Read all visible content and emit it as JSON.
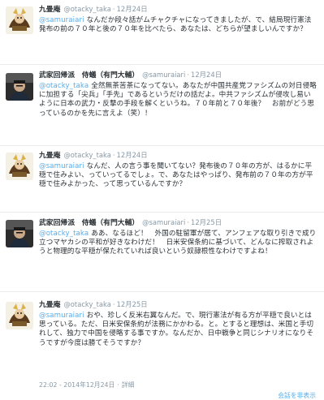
{
  "tweets": [
    {
      "name": "九畳庵",
      "handle": "@otacky_taka",
      "time": "12月24日",
      "mention": "@samuraiari",
      "text": "なんだか段々話がムチャクチャになってきましたが、で、結局現行憲法発布の前の７０年と後の７０年を比べたら、あなたは、どちらが望ましいんですか？"
    },
    {
      "name": "武家回帰派　侍蟻（有門大輔）",
      "handle": "@samuraiari",
      "time": "12月24日",
      "mention": "@otacky_taka",
      "text": "全然無茶苦茶になってない。あなたが中国共産党ファシズムの対日侵略に加担する「尖兵」「手先」であるというだけの話だよ。中共ファシズムが侵攻し易いように日本の武力・反撃の手段を解くというね。７０年前と７０年後？　お前がどう思っているのかを先に言えよ（笑）！"
    },
    {
      "name": "九畳庵",
      "handle": "@otacky_taka",
      "time": "12月24日",
      "mention": "@samuraiari",
      "text": "なんだ、人の言う事を聞いてない？発布後の７０年の方が、はるかに平穏で住みよい、っていってるでしょ。で、あなたはやっぱり、発布前の７０年の方が平穏で住みよかった、って思っているんですか？"
    },
    {
      "name": "武家回帰派　侍蟻（有門大輔）",
      "handle": "@samuraiari",
      "time": "12月25日",
      "mention": "@otacky_taka",
      "text": "ああ、なるほど！　外国の駐留軍が居て、アンフェアな取り引きで成り立つマヤカシの平和が好きなわけだ！　日米安保条約に基づいて、どんなに搾取されようと物理的な平穏が保たれていれば良いという奴隷根性なわけですよね！"
    },
    {
      "name": "九畳庵",
      "handle": "@otacky_taka",
      "time": "12月25日",
      "mention": "@samuraiari",
      "text": "おや、珍しく反米右翼なんだ。で、現行憲法が有る方が平穏で良いとは思っている。ただ、日米安保条約が法務にかかわる。と。とすると理想は、米国と手切れして、独力で中国を侵略する事ですか。なんだか、日中戦争と同じシナリオになりそうですが今度は勝てそうですか？"
    }
  ],
  "footer": {
    "timestamp": "22:02 - 2014年12月24日",
    "separator": "·",
    "details": "詳細",
    "hide_conversation": "会話を非表示"
  },
  "colors": {
    "link": "#55acee",
    "meta": "#8899a6",
    "text": "#292f33",
    "divider": "#e8ecee"
  }
}
